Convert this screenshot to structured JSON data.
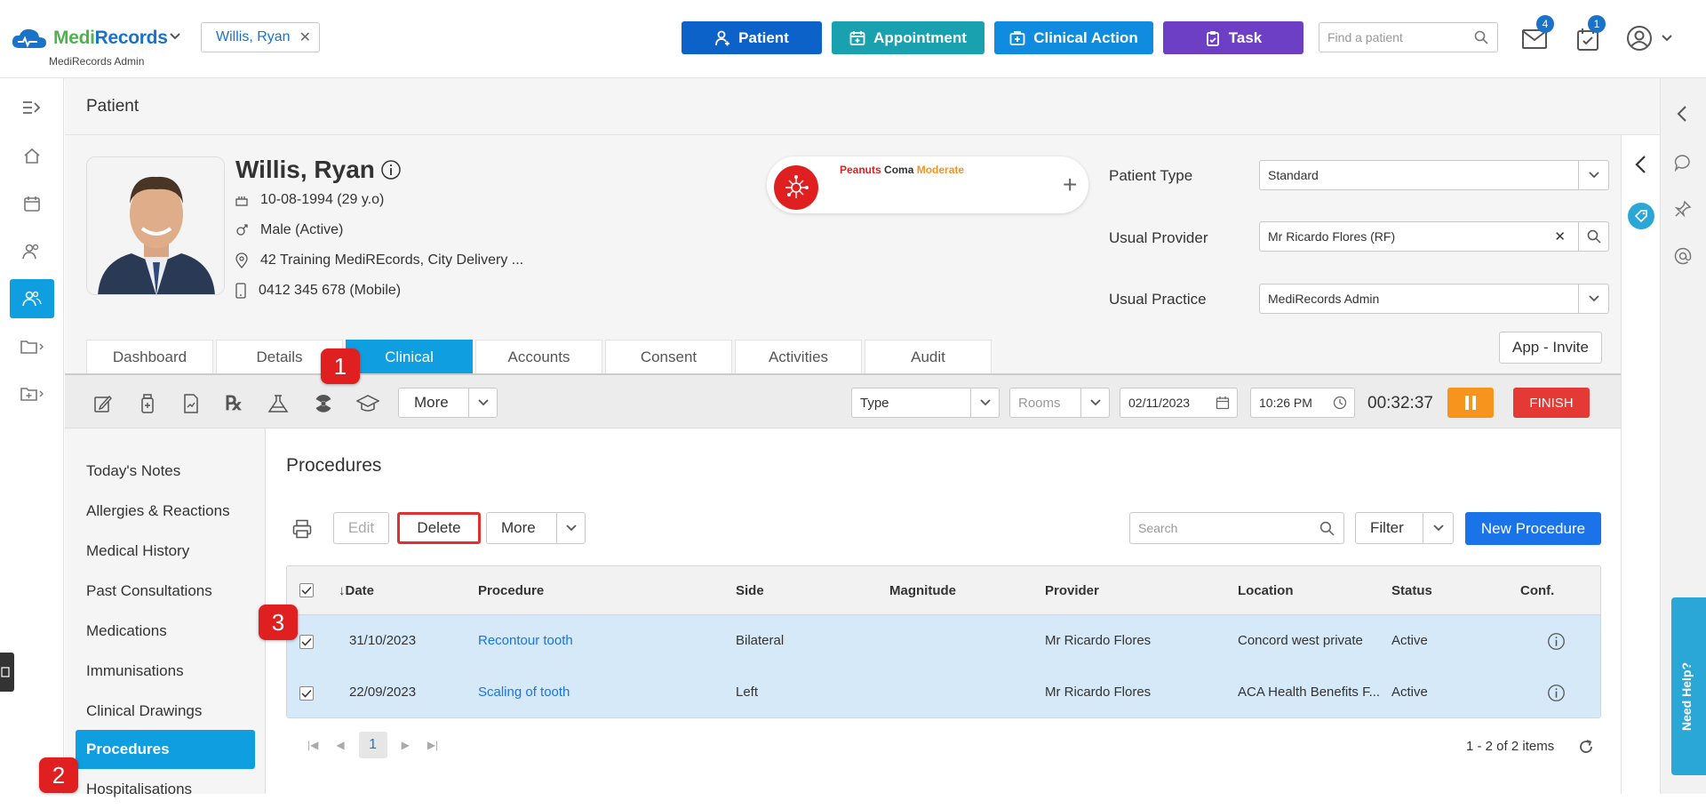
{
  "app": {
    "brand_a": "Medi",
    "brand_b": "Records",
    "org": "MediRecords Admin"
  },
  "patient_chip": {
    "name": "Willis, Ryan"
  },
  "top_actions": [
    {
      "label": "Patient",
      "color": "#0d62c9",
      "icon": "patient-icon"
    },
    {
      "label": "Appointment",
      "color": "#1aa1b0",
      "icon": "calendar-icon"
    },
    {
      "label": "Clinical Action",
      "color": "#0f8be0",
      "icon": "medical-kit-icon"
    },
    {
      "label": "Task",
      "color": "#6c3fc4",
      "icon": "clipboard-icon"
    }
  ],
  "find_patient": {
    "placeholder": "Find a patient"
  },
  "badges": {
    "mail": "4",
    "tasks": "1"
  },
  "page": {
    "title": "Patient"
  },
  "patient": {
    "name": "Willis, Ryan",
    "dob": "10-08-1994 (29 y.o)",
    "gender": "Male (Active)",
    "address": "42 Training MediREcords, City Delivery ...",
    "phone": "0412 345 678 (Mobile)"
  },
  "alert": {
    "allergen": "Peanuts",
    "reaction": "Coma",
    "severity": "Moderate"
  },
  "fields": {
    "patient_type_label": "Patient Type",
    "patient_type_value": "Standard",
    "usual_provider_label": "Usual Provider",
    "usual_provider_value": "Mr Ricardo Flores (RF)",
    "usual_practice_label": "Usual Practice",
    "usual_practice_value": "MediRecords Admin"
  },
  "invite_button": "App - Invite",
  "tabs": [
    "Dashboard",
    "Details",
    "Clinical",
    "Accounts",
    "Consent",
    "Activities",
    "Audit"
  ],
  "active_tab": "Clinical",
  "markers": [
    "1",
    "2",
    "3"
  ],
  "toolbar": {
    "more": "More",
    "type_value": "Type",
    "rooms_placeholder": "Rooms",
    "date": "02/11/2023",
    "time": "10:26 PM",
    "timer": "00:32:37",
    "finish": "FINISH"
  },
  "clinical_menu": [
    "Today's Notes",
    "Allergies & Reactions",
    "Medical History",
    "Past Consultations",
    "Medications",
    "Immunisations",
    "Clinical Drawings",
    "Procedures",
    "Hospitalisations"
  ],
  "active_menu": "Procedures",
  "procedures": {
    "title": "Procedures",
    "edit": "Edit",
    "delete": "Delete",
    "more": "More",
    "search_placeholder": "Search",
    "filter": "Filter",
    "new": "New Procedure",
    "columns": [
      "Date",
      "Procedure",
      "Side",
      "Magnitude",
      "Provider",
      "Location",
      "Status",
      "Conf."
    ],
    "sort_indicator": "↓",
    "rows": [
      {
        "date": "31/10/2023",
        "procedure": "Recontour tooth",
        "side": "Bilateral",
        "magnitude": "",
        "provider": "Mr Ricardo Flores",
        "location": "Concord west private",
        "status": "Active"
      },
      {
        "date": "22/09/2023",
        "procedure": "Scaling of tooth",
        "side": "Left",
        "magnitude": "",
        "provider": "Mr Ricardo Flores",
        "location": "ACA Health Benefits F...",
        "status": "Active"
      }
    ],
    "page": "1",
    "items_text": "1 - 2 of 2 items"
  },
  "need_help": "Need Help?"
}
